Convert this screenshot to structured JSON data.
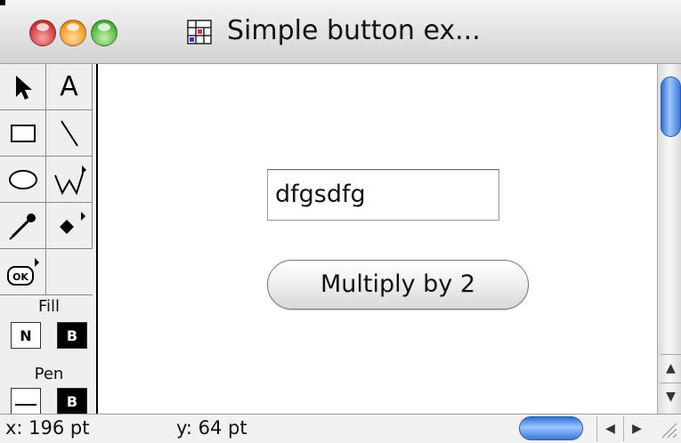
{
  "window": {
    "title": "Simple button ex...",
    "traffic_lights": [
      "close-button",
      "minimize-button",
      "zoom-button"
    ]
  },
  "palette": {
    "tools": [
      "arrow-tool-icon",
      "text-tool-icon",
      "rectangle-tool-icon",
      "line-tool-icon",
      "oval-tool-icon",
      "polygon-tool-icon",
      "eyedropper-tool-icon",
      "point-tool-icon",
      "button-tool-icon"
    ],
    "button_tool_label": "OK",
    "text_tool_label": "A",
    "fill_label": "Fill",
    "fill_options": [
      "N",
      "B"
    ],
    "pen_label": "Pen",
    "pen_option": "B"
  },
  "canvas": {
    "field_value": "dfgsdfg",
    "button_label": "Multiply by 2"
  },
  "status": {
    "x_readout": "x: 196 pt",
    "y_readout": "y: 64 pt"
  }
}
